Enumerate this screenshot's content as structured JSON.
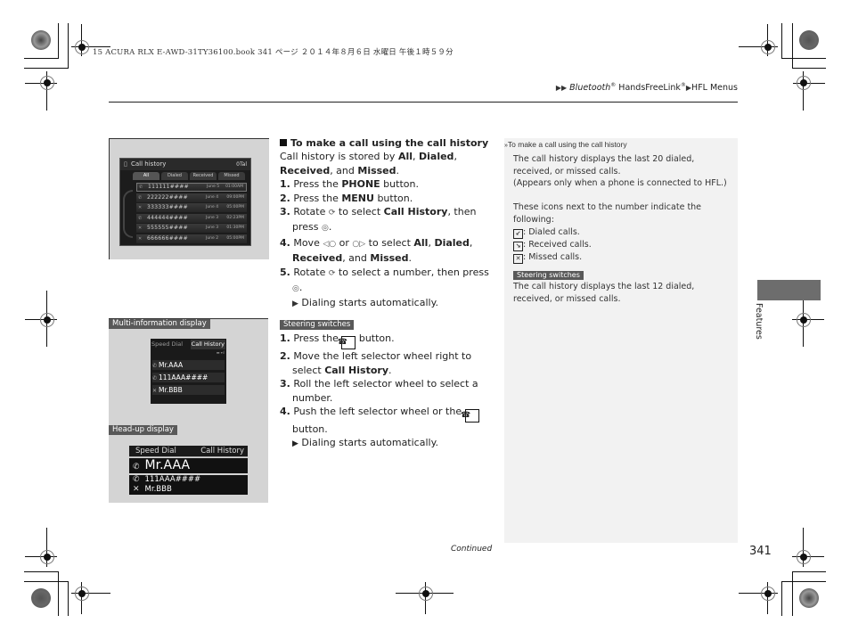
{
  "print_header": "15 ACURA RLX E-AWD-31TY36100.book  341 ページ  ２０１４年８月６日  水曜日  午後１時５９分",
  "breadcrumb": {
    "arrow": "▶▶",
    "part1": "Bluetooth",
    "reg": "®",
    "part2": " HandsFreeLink",
    "reg2": "®",
    "sep": "▶",
    "part3": "HFL Menus"
  },
  "figure1": {
    "screen_title": "Call history",
    "status": "0Tal",
    "tabs": [
      "All",
      "Dialed",
      "Received",
      "Missed"
    ],
    "rows": [
      {
        "icon": "dialed",
        "number": "111111####",
        "date": "June 5",
        "time": "01:00AM"
      },
      {
        "icon": "dialed",
        "number": "222222####",
        "date": "June 4",
        "time": "09:00PM"
      },
      {
        "icon": "missed",
        "number": "333333####",
        "date": "June 4",
        "time": "05:00PM"
      },
      {
        "icon": "dialed",
        "number": "444444####",
        "date": "June 3",
        "time": "02:23PM"
      },
      {
        "icon": "missed",
        "number": "555555####",
        "date": "June 3",
        "time": "01:30PM"
      },
      {
        "icon": "missed",
        "number": "666666####",
        "date": "June 2",
        "time": "05:00PM"
      }
    ]
  },
  "figure2": {
    "mid_label": "Multi-information display",
    "mid_tab_left": "Speed Dial",
    "mid_tab_right": "Call History",
    "mid_rows": [
      "Mr.AAA",
      "111AAA####",
      "Mr.BBB"
    ],
    "hud_label": "Head-up display",
    "hud_tab_left": "Speed Dial",
    "hud_tab_right": "Call History",
    "hud_rows": [
      "Mr.AAA",
      "111AAA####",
      "Mr.BBB"
    ]
  },
  "main": {
    "heading": "To make a call using the call history",
    "intro_a": "Call history is stored by ",
    "intro_all": "All",
    "intro_dialed": "Dialed",
    "intro_received": "Received",
    "intro_and": ", and ",
    "intro_missed": "Missed",
    "s1_num": "1.",
    "s1_a": " Press the ",
    "s1_b": "PHONE",
    "s1_c": " button.",
    "s2_num": "2.",
    "s2_a": " Press the ",
    "s2_b": "MENU",
    "s2_c": " button.",
    "s3_num": "3.",
    "s3_a": " Rotate ",
    "s3_b": " to select ",
    "s3_c": "Call History",
    "s3_d": ", then press ",
    "s4_num": "4.",
    "s4_a": " Move ",
    "s4_or": " or ",
    "s4_b": " to select ",
    "s5_num": "5.",
    "s5_a": " Rotate ",
    "s5_b": " to select a number, then press ",
    "result": "Dialing starts automatically."
  },
  "steering": {
    "label": "Steering switches",
    "s1_num": "1.",
    "s1_a": " Press the ",
    "s1_b": " button.",
    "s2_num": "2.",
    "s2_a": " Move the left selector wheel right to select ",
    "s2_b": "Call History",
    "s3_num": "3.",
    "s3_a": " Roll the left selector wheel to select a number.",
    "s4_num": "4.",
    "s4_a": " Push the left selector wheel or the ",
    "s4_b": " button.",
    "result": "Dialing starts automatically."
  },
  "sidenote": {
    "heading": "To make a call using the call history",
    "p1": "The call history displays the last 20 dialed, received, or missed calls.",
    "p2": "(Appears only when a phone is connected to HFL.)",
    "p3": "These icons next to the number indicate the following:",
    "icon_dialed": ": Dialed calls.",
    "icon_received": ": Received calls.",
    "icon_missed": ": Missed calls.",
    "steer_label": "Steering switches",
    "p4": "The call history displays the last 12 dialed, received, or missed calls."
  },
  "side_tab": "Features",
  "footer": {
    "continued": "Continued",
    "page": "341"
  }
}
